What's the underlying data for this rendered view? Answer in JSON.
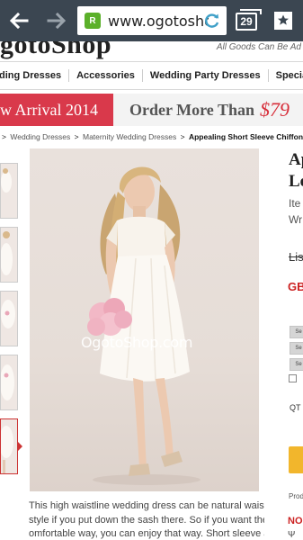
{
  "browser": {
    "url": "www.ogotoshop.com",
    "favicon_glyph": "R",
    "tab_count": "29",
    "icons": [
      "back-arrow-icon",
      "forward-arrow-icon",
      "reload-icon",
      "tabs-icon",
      "bookmark-icon"
    ]
  },
  "site": {
    "logo": "gotoShop",
    "tagline": "All Goods Can Be Ad"
  },
  "categories": [
    {
      "label": "ding Dresses"
    },
    {
      "label": "Accessories"
    },
    {
      "label": "Wedding Party Dresses"
    },
    {
      "label": "Special O"
    }
  ],
  "banners": {
    "new_arrival": "w Arrival 2014",
    "order_more": "Order More Than",
    "order_amount": "$79"
  },
  "breadcrumb": {
    "lead": ">",
    "items": [
      "Wedding Dresses",
      "Maternity Wedding Dresses"
    ],
    "current": "Appealing Short Sleeve Chiffon"
  },
  "product": {
    "title_line1": "Ap",
    "title_line2": "Le",
    "item_no_prefix": "Ite",
    "wr_prefix": "Wr",
    "list_price_prefix": "Lis",
    "sale_price_prefix": "GB",
    "selector_labels": [
      "Se",
      "Se",
      "Se"
    ],
    "qty_label": "QT",
    "prod_label": "Prod",
    "no_label": "NO",
    "section_mark": "Ψ",
    "watermark": "OgotoShop.com"
  },
  "description": [
    "This high waistline wedding dress can be natural waist",
    "style if you put down the sash there. So if you want the c",
    "omfortable way, you can enjoy that way. Short sleeve a"
  ],
  "colors": {
    "chrome": "#3b4651",
    "banner_red": "#d9394b",
    "price_red": "#cc2222",
    "cart_yellow": "#f2b62c"
  }
}
